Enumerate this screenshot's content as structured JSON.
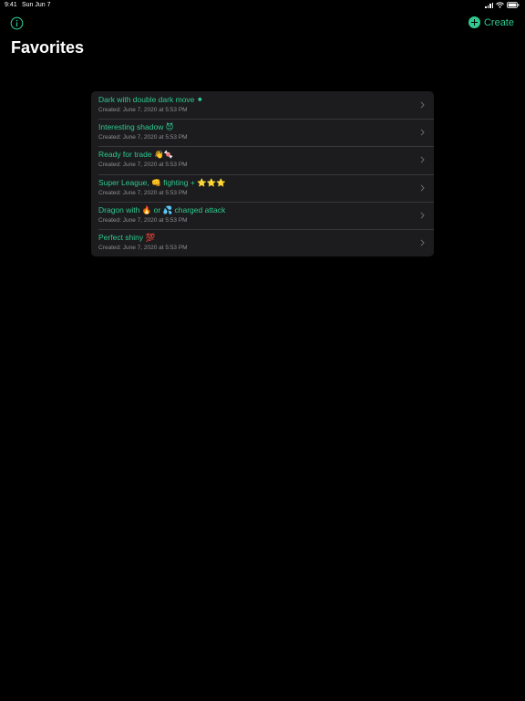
{
  "status_bar": {
    "time": "9:41",
    "date": "Sun Jun 7"
  },
  "header": {
    "info_icon": "info-circle-icon",
    "create_label": "Create",
    "create_icon": "plus-circle-icon",
    "title": "Favorites"
  },
  "colors": {
    "accent": "#2ec98f",
    "background": "#000000",
    "card": "#1c1c1e",
    "secondary_text": "#8e8e93"
  },
  "favorites": {
    "items": [
      {
        "title": "Dark with double dark move ⚫",
        "subtitle": "Created: June 7, 2020 at 5:53 PM"
      },
      {
        "title": "Interesting shadow 😈",
        "subtitle": "Created: June 7, 2020 at 5:53 PM"
      },
      {
        "title": "Ready for trade 👋🍬",
        "subtitle": "Created: June 7, 2020 at 5:53 PM"
      },
      {
        "title": "Super League, 👊 fighting + ⭐⭐⭐",
        "subtitle": "Created: June 7, 2020 at 5:53 PM"
      },
      {
        "title": "Dragon with 🔥 or 💦 charged attack",
        "subtitle": "Created: June 7, 2020 at 5:53 PM"
      },
      {
        "title": "Perfect shiny 💯",
        "subtitle": "Created: June 7, 2020 at 5:53 PM"
      }
    ]
  }
}
